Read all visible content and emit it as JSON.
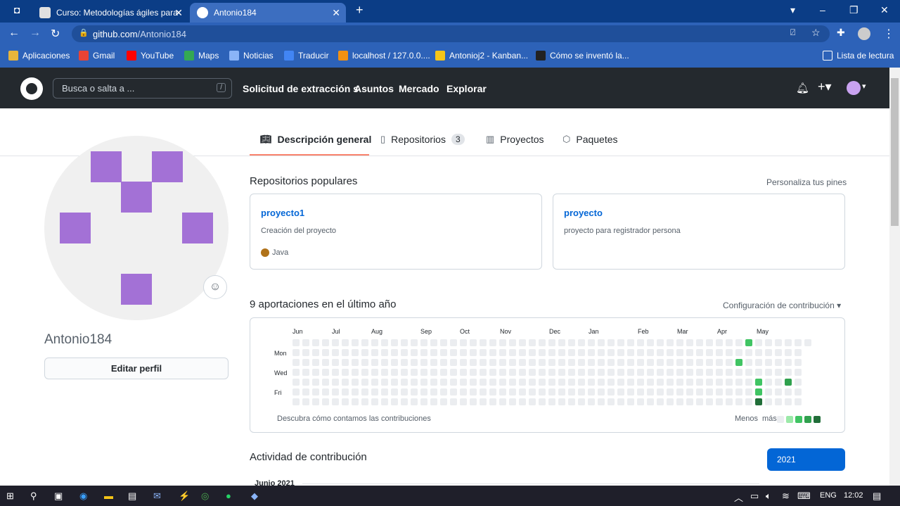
{
  "browser": {
    "tabs": [
      {
        "title": "Curso: Metodologías ágiles para"
      },
      {
        "title": "Antonio184"
      }
    ],
    "url_host": "github.com",
    "url_path": "/Antonio184",
    "bookmarks": [
      "Aplicaciones",
      "Gmail",
      "YouTube",
      "Maps",
      "Noticias",
      "Traducir",
      "localhost / 127.0.0....",
      "Antonioj2 - Kanban...",
      "Cómo se inventó la..."
    ],
    "reading_list": "Lista de lectura"
  },
  "github": {
    "search_placeholder": "Busca o salta a ...",
    "search_key": "/",
    "nav": [
      "Solicitud de extracción s",
      "Asuntos",
      "Mercado",
      "Explorar"
    ]
  },
  "profile": {
    "tabs": [
      {
        "label": "Descripción general"
      },
      {
        "label": "Repositorios",
        "count": "3"
      },
      {
        "label": "Proyectos"
      },
      {
        "label": "Paquetes"
      }
    ],
    "username": "Antonio184",
    "edit_button": "Editar perfil",
    "popular_title": "Repositorios populares",
    "customize_pins": "Personaliza tus pines",
    "repos": [
      {
        "name": "proyecto1",
        "description": "Creación del proyecto",
        "language": "Java"
      },
      {
        "name": "proyecto",
        "description": "proyecto para registrador persona"
      }
    ],
    "contrib_title": "9 aportaciones en el último año",
    "contrib_settings": "Configuración de contribución",
    "months": [
      "Jun",
      "Jul",
      "Aug",
      "Sep",
      "Oct",
      "Nov",
      "Dec",
      "Jan",
      "Feb",
      "Mar",
      "Apr",
      "May"
    ],
    "days": [
      "Mon",
      "Wed",
      "Fri"
    ],
    "learn_link": "Descubra cómo contamos las contribuciones",
    "legend_less": "Menos",
    "legend_more": "más",
    "activity_title": "Actividad de contribución",
    "year": "2021",
    "timeline_month": "Junio 2021",
    "colors": {
      "empty": "#ebedf0",
      "l1": "#9be9a8",
      "l2": "#40c463",
      "l3": "#30a14e",
      "l4": "#216e39"
    }
  },
  "taskbar": {
    "lang": "ENG",
    "time": "12:02"
  }
}
